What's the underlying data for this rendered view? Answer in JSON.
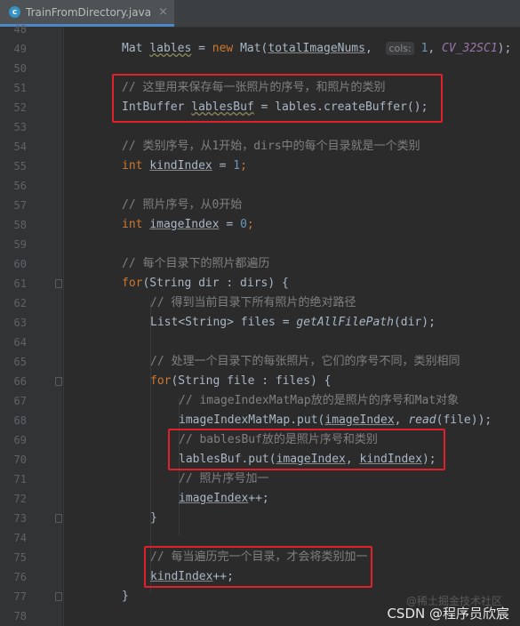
{
  "tab": {
    "icon": "c",
    "label": "TrainFromDirectory.java",
    "close": "×"
  },
  "line_numbers": [
    "48",
    "49",
    "50",
    "51",
    "52",
    "53",
    "54",
    "55",
    "56",
    "57",
    "58",
    "59",
    "60",
    "61",
    "62",
    "63",
    "64",
    "65",
    "66",
    "67",
    "68",
    "69",
    "70",
    "71",
    "72",
    "73",
    "74",
    "75",
    "76",
    "77",
    "78"
  ],
  "code": {
    "l49": {
      "a": "Mat ",
      "b": "lables",
      "c": " = ",
      "d": "new",
      "e": " Mat(",
      "f": "totalImageNums",
      "g": ",  ",
      "hint": "cols:",
      "h": " ",
      "i": "1",
      "j": ", ",
      "k": "CV_32SC1",
      "l": ");"
    },
    "l51": "// 这里用来保存每一张照片的序号，和照片的类别",
    "l52": {
      "a": "IntBuffer ",
      "b": "lablesBuf",
      "c": " = lables.createBuffer();"
    },
    "l54": "// 类别序号，从1开始，dirs中的每个目录就是一个类别",
    "l55": {
      "a": "int",
      "b": " ",
      "c": "kindIndex",
      "d": " = ",
      "e": "1",
      "f": ";"
    },
    "l57": "// 照片序号，从0开始",
    "l58": {
      "a": "int",
      "b": " ",
      "c": "imageIndex",
      "d": " = ",
      "e": "0",
      "f": ";"
    },
    "l60": "// 每个目录下的照片都遍历",
    "l61": {
      "a": "for",
      "b": "(String dir : dirs) {"
    },
    "l62": "// 得到当前目录下所有照片的绝对路径",
    "l63": {
      "a": "List<String> files = ",
      "b": "getAllFilePath",
      "c": "(dir);"
    },
    "l65": "// 处理一个目录下的每张照片，它们的序号不同，类别相同",
    "l66": {
      "a": "for",
      "b": "(String file : files) {"
    },
    "l67": "// imageIndexMatMap放的是照片的序号和Mat对象",
    "l68": {
      "a": "imageIndexMatMap.put(",
      "b": "imageIndex",
      "c": ", ",
      "d": "read",
      "e": "(file));"
    },
    "l69": "// bablesBuf放的是照片序号和类别",
    "l70": {
      "a": "lablesBuf.put(",
      "b": "imageIndex",
      "c": ", ",
      "d": "kindIndex",
      "e": ");"
    },
    "l71": "// 照片序号加一",
    "l72": {
      "a": "imageIndex",
      "b": "++;"
    },
    "l73": "}",
    "l75": "// 每当遍历完一个目录，才会将类别加一",
    "l76": {
      "a": "kindIndex",
      "b": "++;"
    },
    "l77": "}"
  },
  "watermark": {
    "text": "CSDN @程序员欣宸",
    "ghost": "@稀土掘金技术社区"
  },
  "colors": {
    "highlight_box": "#e0202a",
    "keyword": "#cc7832",
    "comment": "#808080",
    "number": "#6897bb",
    "constant": "#9876aa"
  }
}
